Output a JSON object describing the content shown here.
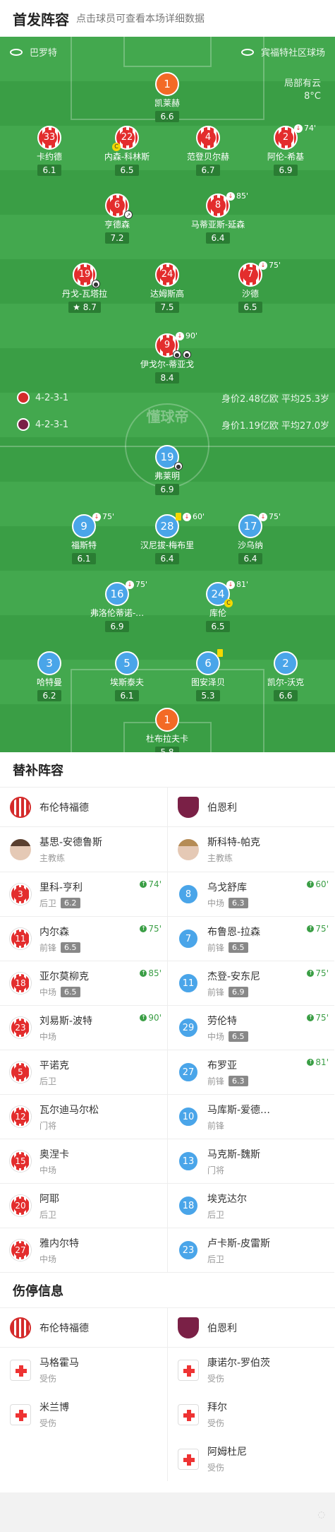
{
  "header": {
    "title": "首发阵容",
    "hint": "点击球员可查看本场详细数据"
  },
  "pitch": {
    "home_team": "巴罗特",
    "away_team": "宾福特社区球场",
    "weather": [
      "局部有云",
      "8°C"
    ],
    "watermark": "懂球帝",
    "home_formation": "4-2-3-1",
    "home_value": "身价2.48亿欧  平均25.3岁",
    "away_formation": "4-2-3-1",
    "away_value": "身价1.19亿欧  平均27.0岁"
  },
  "colors": {
    "pitch": "#3a9e45",
    "home": "#e32d2d",
    "away": "#4aa5e9",
    "keeper": "#f36a26"
  },
  "home_players": [
    {
      "num": "1",
      "name": "凯莱赫",
      "rating": "6.6",
      "gk": true
    },
    {
      "num": "33",
      "name": "卡约德",
      "rating": "6.1"
    },
    {
      "num": "22",
      "name": "内森-科林斯",
      "rating": "6.5",
      "captain": true
    },
    {
      "num": "4",
      "name": "范登贝尔赫",
      "rating": "6.7"
    },
    {
      "num": "2",
      "name": "阿伦-希基",
      "rating": "6.9",
      "sub": "74'"
    },
    {
      "num": "6",
      "name": "亨德森",
      "rating": "7.2"
    },
    {
      "num": "8",
      "name": "马蒂亚斯-延森",
      "rating": "6.4",
      "sub": "85'"
    },
    {
      "num": "19",
      "name": "丹戈-瓦塔拉",
      "rating": "8.7",
      "star": true
    },
    {
      "num": "24",
      "name": "达姆斯高",
      "rating": "7.5"
    },
    {
      "num": "7",
      "name": "沙德",
      "rating": "6.5",
      "sub": "75'"
    },
    {
      "num": "9",
      "name": "伊戈尔-蒂亚戈",
      "rating": "8.4",
      "sub": "90'"
    }
  ],
  "away_players": [
    {
      "num": "19",
      "name": "弗莱明",
      "rating": "6.9"
    },
    {
      "num": "9",
      "name": "福斯特",
      "rating": "6.1",
      "sub": "75'"
    },
    {
      "num": "28",
      "name": "汉尼拔-梅布里",
      "rating": "6.4",
      "sub": "60'"
    },
    {
      "num": "17",
      "name": "沙乌纳",
      "rating": "6.4",
      "sub": "75'"
    },
    {
      "num": "16",
      "name": "弗洛伦蒂诺-…",
      "rating": "6.9",
      "sub": "75'"
    },
    {
      "num": "24",
      "name": "库伦",
      "rating": "6.5",
      "sub": "81'"
    },
    {
      "num": "3",
      "name": "哈特曼",
      "rating": "6.2"
    },
    {
      "num": "5",
      "name": "埃斯泰夫",
      "rating": "6.1"
    },
    {
      "num": "6",
      "name": "图安泽贝",
      "rating": "5.3"
    },
    {
      "num": "2",
      "name": "凯尔-沃克",
      "rating": "6.6"
    },
    {
      "num": "1",
      "name": "杜布拉夫卡",
      "rating": "5.8",
      "gk": true
    }
  ],
  "subs": {
    "title": "替补阵容",
    "home_team": "布伦特福德",
    "away_team": "伯恩利",
    "home_coach": {
      "name": "基思-安德鲁斯",
      "role": "主教练"
    },
    "away_coach": {
      "name": "斯科特-帕克",
      "role": "主教练"
    },
    "home": [
      {
        "num": "3",
        "name": "里科-亨利",
        "pos": "后卫",
        "rating": "6.2",
        "time": "74'"
      },
      {
        "num": "11",
        "name": "内尔森",
        "pos": "前锋",
        "rating": "6.5",
        "time": "75'"
      },
      {
        "num": "18",
        "name": "亚尔莫柳克",
        "pos": "中场",
        "rating": "6.5",
        "time": "85'"
      },
      {
        "num": "23",
        "name": "刘易斯-波特",
        "pos": "中场",
        "rating": "",
        "time": "90'"
      },
      {
        "num": "5",
        "name": "平诺克",
        "pos": "后卫",
        "rating": "",
        "time": ""
      },
      {
        "num": "12",
        "name": "瓦尔迪马尔松",
        "pos": "门将",
        "rating": "",
        "time": ""
      },
      {
        "num": "15",
        "name": "奥涅卡",
        "pos": "中场",
        "rating": "",
        "time": ""
      },
      {
        "num": "20",
        "name": "阿耶",
        "pos": "后卫",
        "rating": "",
        "time": ""
      },
      {
        "num": "27",
        "name": "雅内尔特",
        "pos": "中场",
        "rating": "",
        "time": ""
      }
    ],
    "away": [
      {
        "num": "8",
        "name": "乌戈舒库",
        "pos": "中场",
        "rating": "6.3",
        "time": "60'"
      },
      {
        "num": "7",
        "name": "布鲁恩-拉森",
        "pos": "前锋",
        "rating": "6.5",
        "time": "75'"
      },
      {
        "num": "11",
        "name": "杰登-安东尼",
        "pos": "前锋",
        "rating": "6.9",
        "time": "75'"
      },
      {
        "num": "29",
        "name": "劳伦特",
        "pos": "中场",
        "rating": "6.5",
        "time": "75'"
      },
      {
        "num": "27",
        "name": "布罗亚",
        "pos": "前锋",
        "rating": "6.3",
        "time": "81'"
      },
      {
        "num": "10",
        "name": "马库斯-爱德…",
        "pos": "前锋",
        "rating": "",
        "time": ""
      },
      {
        "num": "13",
        "name": "马克斯-魏斯",
        "pos": "门将",
        "rating": "",
        "time": ""
      },
      {
        "num": "18",
        "name": "埃克达尔",
        "pos": "后卫",
        "rating": "",
        "time": ""
      },
      {
        "num": "23",
        "name": "卢卡斯-皮雷斯",
        "pos": "后卫",
        "rating": "",
        "time": ""
      }
    ]
  },
  "injuries": {
    "title": "伤停信息",
    "home_team": "布伦特福德",
    "away_team": "伯恩利",
    "home": [
      {
        "name": "马格霍马",
        "status": "受伤"
      },
      {
        "name": "米兰博",
        "status": "受伤"
      }
    ],
    "away": [
      {
        "name": "康诺尔-罗伯茨",
        "status": "受伤"
      },
      {
        "name": "拜尔",
        "status": "受伤"
      },
      {
        "name": "阿姆杜尼",
        "status": "受伤"
      }
    ]
  }
}
